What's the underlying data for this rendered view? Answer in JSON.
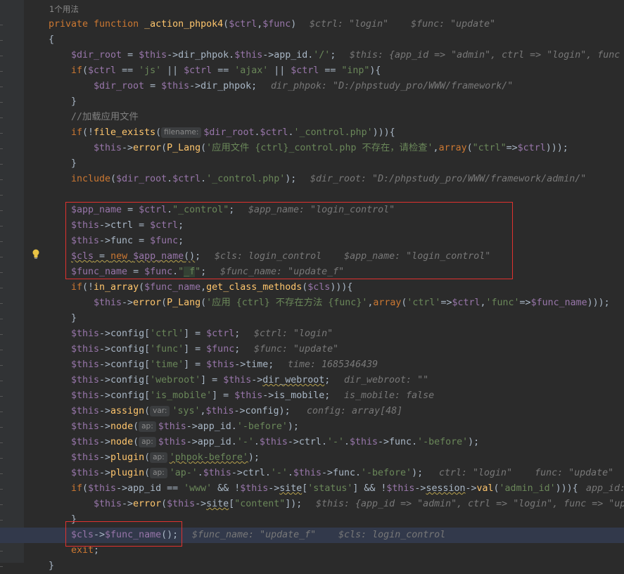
{
  "editor": {
    "usages": "1个用法",
    "lines": [
      {
        "seg": [
          [
            "kw",
            "private function "
          ],
          [
            "fn",
            "_action_phpok4"
          ],
          [
            "",
            "("
          ],
          [
            "var",
            "$ctrl"
          ],
          [
            "",
            ","
          ],
          [
            "var",
            "$func"
          ],
          [
            "",
            ")"
          ]
        ],
        "hint": "$ctrl: \"login\"    $func: \"update\""
      },
      {
        "seg": [
          [
            "",
            "{"
          ]
        ]
      },
      {
        "seg": [
          [
            "var",
            "$dir_root"
          ],
          [
            "",
            " = "
          ],
          [
            "var",
            "$this"
          ],
          [
            "",
            "->dir_phpok."
          ],
          [
            "var",
            "$this"
          ],
          [
            "",
            "->app_id."
          ],
          [
            "str",
            "'/'"
          ],
          [
            "",
            ";"
          ]
        ],
        "hint": "$this: {app_id => \"admin\", ctrl => \"login\", func"
      },
      {
        "seg": [
          [
            "kw",
            "if"
          ],
          [
            "",
            "("
          ],
          [
            "var",
            "$ctrl"
          ],
          [
            "",
            " == "
          ],
          [
            "str",
            "'js'"
          ],
          [
            "",
            " || "
          ],
          [
            "var",
            "$ctrl"
          ],
          [
            "",
            " == "
          ],
          [
            "str",
            "'ajax'"
          ],
          [
            "",
            " || "
          ],
          [
            "var",
            "$ctrl"
          ],
          [
            "",
            " == "
          ],
          [
            "str",
            "\"inp\""
          ],
          [
            "",
            "){"
          ]
        ]
      },
      {
        "seg": [
          [
            "var",
            "$dir_root"
          ],
          [
            "",
            " = "
          ],
          [
            "var",
            "$this"
          ],
          [
            "",
            "->dir_phpok;"
          ]
        ],
        "hint": "dir_phpok: \"D:/phpstudy_pro/WWW/framework/\""
      },
      {
        "seg": [
          [
            "",
            "}"
          ]
        ]
      },
      {
        "seg": [
          [
            "cmt",
            "//加载应用文件"
          ]
        ]
      },
      {
        "seg": [
          [
            "kw",
            "if"
          ],
          [
            "",
            "(!"
          ],
          [
            "fn",
            "file_exists"
          ],
          [
            "",
            "("
          ],
          [
            "tag",
            "filename:"
          ],
          [
            "var",
            "$dir_root"
          ],
          [
            "",
            "."
          ],
          [
            "var",
            "$ctrl"
          ],
          [
            "",
            "."
          ],
          [
            "str",
            "'_control.php'"
          ],
          [
            "",
            "))){"
          ]
        ]
      },
      {
        "seg": [
          [
            "var",
            "$this"
          ],
          [
            "",
            "->"
          ],
          [
            "fn",
            "error"
          ],
          [
            "",
            "("
          ],
          [
            "fn",
            "P_Lang"
          ],
          [
            "",
            "("
          ],
          [
            "str",
            "'应用文件 {ctrl}_control.php 不存在，请检查'"
          ],
          [
            "",
            ","
          ],
          [
            "kw",
            "array"
          ],
          [
            "",
            "("
          ],
          [
            "str",
            "\"ctrl\""
          ],
          [
            "",
            "=>"
          ],
          [
            "var",
            "$ctrl"
          ],
          [
            "",
            ")));"
          ]
        ]
      },
      {
        "seg": [
          [
            "",
            "}"
          ]
        ]
      },
      {
        "seg": [
          [
            "kw",
            "include"
          ],
          [
            "",
            "("
          ],
          [
            "var",
            "$dir_root"
          ],
          [
            "",
            "."
          ],
          [
            "var",
            "$ctrl"
          ],
          [
            "",
            "."
          ],
          [
            "str",
            "'_control.php'"
          ],
          [
            "",
            ");"
          ]
        ],
        "hint": "$dir_root: \"D:/phpstudy_pro/WWW/framework/admin/\""
      },
      {
        "seg": []
      },
      {
        "seg": [
          [
            "var",
            "$app_name"
          ],
          [
            "",
            " = "
          ],
          [
            "var",
            "$ctrl"
          ],
          [
            "",
            "."
          ],
          [
            "str",
            "\"_control\""
          ],
          [
            "",
            ";"
          ]
        ],
        "hint": "$app_name: \"login_control\""
      },
      {
        "seg": [
          [
            "var",
            "$this"
          ],
          [
            "",
            "->ctrl = "
          ],
          [
            "var",
            "$ctrl"
          ],
          [
            "",
            ";"
          ]
        ]
      },
      {
        "seg": [
          [
            "var",
            "$this"
          ],
          [
            "",
            "->func = "
          ],
          [
            "var",
            "$func"
          ],
          [
            "",
            ";"
          ]
        ]
      },
      {
        "seg": [
          [
            "var squig",
            "$cls"
          ],
          [
            "squig",
            " = "
          ],
          [
            "kw squig",
            "new "
          ],
          [
            "var squig",
            "$app_name"
          ],
          [
            "squig",
            "()"
          ],
          [
            "",
            ";"
          ]
        ],
        "hint": "$cls: login_control    $app_name: \"login_control\""
      },
      {
        "seg": [
          [
            "var",
            "$func_name"
          ],
          [
            "",
            " = "
          ],
          [
            "var",
            "$func"
          ],
          [
            "",
            "."
          ],
          [
            "str",
            "\""
          ],
          [
            "str greenbox",
            "_f"
          ],
          [
            "str",
            "\""
          ],
          [
            "",
            ";"
          ]
        ],
        "hint": "$func_name: \"update_f\""
      },
      {
        "seg": [
          [
            "kw",
            "if"
          ],
          [
            "",
            "(!"
          ],
          [
            "fn",
            "in_array"
          ],
          [
            "",
            "("
          ],
          [
            "var",
            "$func_name"
          ],
          [
            "",
            ","
          ],
          [
            "fn",
            "get_class_methods"
          ],
          [
            "",
            "("
          ],
          [
            "var",
            "$cls"
          ],
          [
            "",
            "))){"
          ]
        ]
      },
      {
        "seg": [
          [
            "var",
            "$this"
          ],
          [
            "",
            "->"
          ],
          [
            "fn",
            "error"
          ],
          [
            "",
            "("
          ],
          [
            "fn",
            "P_Lang"
          ],
          [
            "",
            "("
          ],
          [
            "str",
            "'应用 {ctrl} 不存在方法 {func}'"
          ],
          [
            "",
            ","
          ],
          [
            "kw",
            "array"
          ],
          [
            "",
            "("
          ],
          [
            "str",
            "'ctrl'"
          ],
          [
            "",
            "=>"
          ],
          [
            "var",
            "$ctrl"
          ],
          [
            "",
            ","
          ],
          [
            "str",
            "'func'"
          ],
          [
            "",
            "=>"
          ],
          [
            "var",
            "$func_name"
          ],
          [
            "",
            ")));"
          ]
        ]
      },
      {
        "seg": [
          [
            "",
            "}"
          ]
        ]
      },
      {
        "seg": [
          [
            "var",
            "$this"
          ],
          [
            "",
            "->config["
          ],
          [
            "str",
            "'ctrl'"
          ],
          [
            "",
            "] = "
          ],
          [
            "var",
            "$ctrl"
          ],
          [
            "",
            ";"
          ]
        ],
        "hint": "$ctrl: \"login\""
      },
      {
        "seg": [
          [
            "var",
            "$this"
          ],
          [
            "",
            "->config["
          ],
          [
            "str",
            "'func'"
          ],
          [
            "",
            "] = "
          ],
          [
            "var",
            "$func"
          ],
          [
            "",
            ";"
          ]
        ],
        "hint": "$func: \"update\""
      },
      {
        "seg": [
          [
            "var",
            "$this"
          ],
          [
            "",
            "->config["
          ],
          [
            "str",
            "'time'"
          ],
          [
            "",
            "] = "
          ],
          [
            "var",
            "$this"
          ],
          [
            "",
            "->time;"
          ]
        ],
        "hint": "time: 1685346439"
      },
      {
        "seg": [
          [
            "var",
            "$this"
          ],
          [
            "",
            "->config["
          ],
          [
            "str",
            "'webroot'"
          ],
          [
            "",
            "] = "
          ],
          [
            "var",
            "$this"
          ],
          [
            "",
            "->"
          ],
          [
            "squig",
            "dir_webroot"
          ],
          [
            "",
            ";"
          ]
        ],
        "hint": "dir_webroot: \"\""
      },
      {
        "seg": [
          [
            "var",
            "$this"
          ],
          [
            "",
            "->config["
          ],
          [
            "str",
            "'is_mobile'"
          ],
          [
            "",
            "] = "
          ],
          [
            "var",
            "$this"
          ],
          [
            "",
            "->is_mobile;"
          ]
        ],
        "hint": "is_mobile: false"
      },
      {
        "seg": [
          [
            "var",
            "$this"
          ],
          [
            "",
            "->"
          ],
          [
            "fn",
            "assign"
          ],
          [
            "",
            "("
          ],
          [
            "tag",
            "var:"
          ],
          [
            "str",
            "'sys'"
          ],
          [
            "",
            ","
          ],
          [
            "var",
            "$this"
          ],
          [
            "",
            "->config);"
          ]
        ],
        "hint": "config: array[48]"
      },
      {
        "seg": [
          [
            "var",
            "$this"
          ],
          [
            "",
            "->"
          ],
          [
            "fn",
            "node"
          ],
          [
            "",
            "("
          ],
          [
            "tag",
            "ap:"
          ],
          [
            "var",
            "$this"
          ],
          [
            "",
            "->app_id."
          ],
          [
            "str",
            "'-before'"
          ],
          [
            "",
            ");"
          ]
        ]
      },
      {
        "seg": [
          [
            "var",
            "$this"
          ],
          [
            "",
            "->"
          ],
          [
            "fn",
            "node"
          ],
          [
            "",
            "("
          ],
          [
            "tag",
            "ap:"
          ],
          [
            "var",
            "$this"
          ],
          [
            "",
            "->app_id."
          ],
          [
            "str",
            "'-'"
          ],
          [
            "",
            "."
          ],
          [
            "var",
            "$this"
          ],
          [
            "",
            "->ctrl."
          ],
          [
            "str",
            "'-'"
          ],
          [
            "",
            "."
          ],
          [
            "var",
            "$this"
          ],
          [
            "",
            "->func."
          ],
          [
            "str",
            "'-before'"
          ],
          [
            "",
            ");"
          ]
        ]
      },
      {
        "seg": [
          [
            "var",
            "$this"
          ],
          [
            "",
            "->"
          ],
          [
            "fn",
            "plugin"
          ],
          [
            "",
            "("
          ],
          [
            "tag",
            "ap:"
          ],
          [
            "str squig",
            "'phpok-before'"
          ],
          [
            "",
            ");"
          ]
        ]
      },
      {
        "seg": [
          [
            "var",
            "$this"
          ],
          [
            "",
            "->"
          ],
          [
            "fn",
            "plugin"
          ],
          [
            "",
            "("
          ],
          [
            "tag",
            "ap:"
          ],
          [
            "str",
            "'ap-'"
          ],
          [
            "",
            "."
          ],
          [
            "var",
            "$this"
          ],
          [
            "",
            "->ctrl."
          ],
          [
            "str",
            "'-'"
          ],
          [
            "",
            "."
          ],
          [
            "var",
            "$this"
          ],
          [
            "",
            "->func."
          ],
          [
            "str",
            "'-before'"
          ],
          [
            "",
            ");"
          ]
        ],
        "hint": "ctrl: \"login\"    func: \"update\""
      },
      {
        "seg": [
          [
            "kw",
            "if"
          ],
          [
            "",
            "("
          ],
          [
            "var",
            "$this"
          ],
          [
            "",
            "->app_id == "
          ],
          [
            "str",
            "'www'"
          ],
          [
            "",
            " && !"
          ],
          [
            "var",
            "$this"
          ],
          [
            "",
            "->"
          ],
          [
            "squig",
            "site"
          ],
          [
            "",
            "["
          ],
          [
            "str",
            "'status'"
          ],
          [
            "",
            "] && !"
          ],
          [
            "var",
            "$this"
          ],
          [
            "",
            "->"
          ],
          [
            "squig",
            "session"
          ],
          [
            "",
            "->"
          ],
          [
            "fn",
            "val"
          ],
          [
            "",
            "("
          ],
          [
            "str",
            "'admin_id'"
          ],
          [
            "",
            "))){"
          ]
        ],
        "hint": "app_id:"
      },
      {
        "seg": [
          [
            "var",
            "$this"
          ],
          [
            "",
            "->"
          ],
          [
            "fn",
            "error"
          ],
          [
            "",
            "("
          ],
          [
            "var",
            "$this"
          ],
          [
            "",
            "->"
          ],
          [
            "squig",
            "site"
          ],
          [
            "",
            "["
          ],
          [
            "str",
            "\"content\""
          ],
          [
            "",
            "]);"
          ]
        ],
        "hint": "$this: {app_id => \"admin\", ctrl => \"login\", func => \"up"
      },
      {
        "seg": [
          [
            "",
            "}"
          ]
        ]
      },
      {
        "seg": [
          [
            "var",
            "$cls"
          ],
          [
            "",
            "->"
          ],
          [
            "var",
            "$func_name"
          ],
          [
            "",
            "();"
          ]
        ],
        "hint": "$func_name: \"update_f\"    $cls: login_control"
      },
      {
        "seg": [
          [
            "kw",
            "exit"
          ],
          [
            "",
            ";"
          ]
        ]
      },
      {
        "seg": [
          [
            "",
            "}"
          ]
        ]
      }
    ]
  }
}
